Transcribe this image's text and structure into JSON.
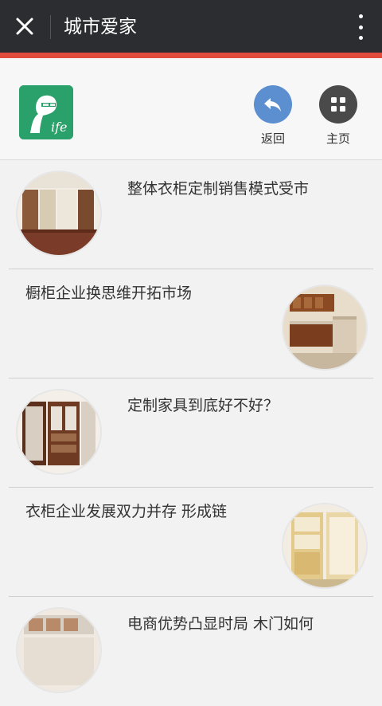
{
  "topbar": {
    "title": "城市爱家",
    "close_icon": "close-icon",
    "more_icon": "more-vertical-icon"
  },
  "header": {
    "logo_text": "ife",
    "back_label": "返回",
    "home_label": "主页",
    "back_color": "#5b8fcf",
    "home_color": "#4a4a4a"
  },
  "articles": [
    {
      "title": "整体衣柜定制销售模式受市"
    },
    {
      "title": "橱柜企业换思维开拓市场"
    },
    {
      "title": "定制家具到底好不好？"
    },
    {
      "title": "衣柜企业发展双力并存 形成链"
    },
    {
      "title": "电商优势凸显时局 木门如何"
    }
  ],
  "colors": {
    "topbar": "#2b2d31",
    "accent": "#e14b3c",
    "logo": "#2aa06a"
  }
}
